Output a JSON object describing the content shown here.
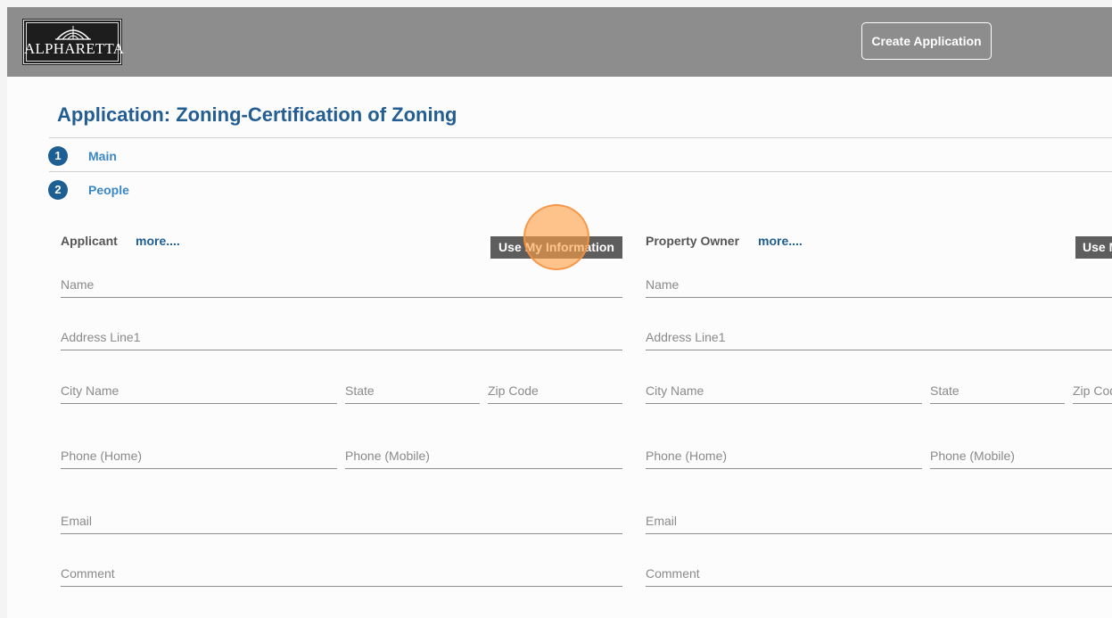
{
  "header": {
    "logo_text": "ALPHARETTA",
    "create_button_label": "Create Application"
  },
  "page": {
    "title": "Application: Zoning-Certification of Zoning"
  },
  "steps": [
    {
      "number": "1",
      "label": "Main"
    },
    {
      "number": "2",
      "label": "People"
    }
  ],
  "applicant": {
    "title": "Applicant",
    "more_label": "more....",
    "use_info_label": "Use My Information",
    "fields": {
      "name": "Name",
      "address_line1": "Address Line1",
      "city": "City Name",
      "state": "State",
      "zip": "Zip Code",
      "phone_home": "Phone (Home)",
      "phone_mobile": "Phone (Mobile)",
      "email": "Email",
      "comment": "Comment"
    }
  },
  "property_owner": {
    "title": "Property Owner",
    "more_label": "more....",
    "use_info_label": "Use My Information",
    "fields": {
      "name": "Name",
      "address_line1": "Address Line1",
      "city": "City Name",
      "state": "State",
      "zip": "Zip Code",
      "phone_home": "Phone (Home)",
      "phone_mobile": "Phone (Mobile)",
      "email": "Email",
      "comment": "Comment"
    }
  },
  "colors": {
    "header_bg": "#8d8d8d",
    "title": "#235d91",
    "step_badge": "#1e5f93",
    "step_link": "#3a87c4",
    "button_dark": "#5e5e5e",
    "click_highlight": "#ff9e46"
  }
}
